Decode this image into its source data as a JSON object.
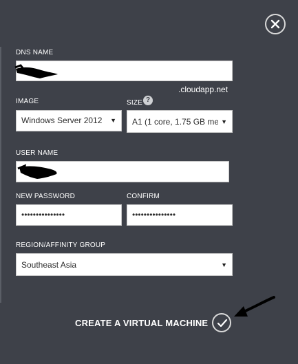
{
  "form": {
    "dns_name": {
      "label": "DNS NAME",
      "value": "",
      "suffix": ".cloudapp.net"
    },
    "image": {
      "label": "IMAGE",
      "selected": "Windows Server 2012"
    },
    "size": {
      "label": "SIZE",
      "selected": "A1 (1 core, 1.75 GB me"
    },
    "user_name": {
      "label": "USER NAME",
      "value": ""
    },
    "new_password": {
      "label": "NEW PASSWORD",
      "value": "•••••••••••••••"
    },
    "confirm": {
      "label": "CONFIRM",
      "value": "•••••••••••••••"
    },
    "region": {
      "label": "REGION/AFFINITY GROUP",
      "selected": "Southeast Asia"
    }
  },
  "footer": {
    "create_label": "CREATE A VIRTUAL MACHINE"
  },
  "icons": {
    "close": "close-icon",
    "help": "help-icon",
    "check": "checkmark-icon",
    "dropdown": "chevron-down-icon",
    "annotation": "arrow-annotation"
  },
  "colors": {
    "background": "#3e4149",
    "field": "#ffffff",
    "text": "#ffffff"
  }
}
